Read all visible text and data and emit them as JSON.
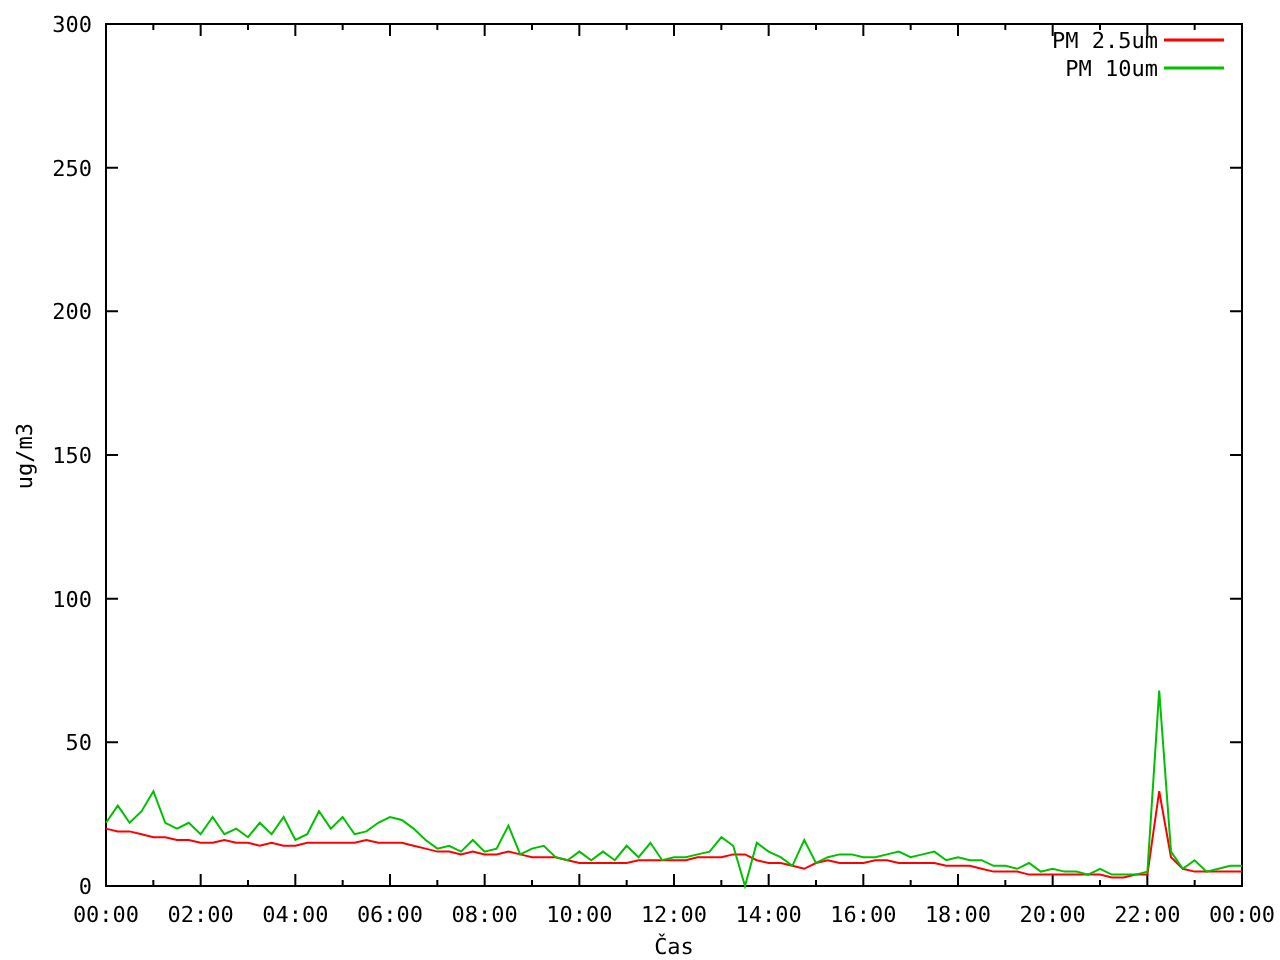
{
  "chart_data": {
    "type": "line",
    "xlabel": "Čas",
    "ylabel": "ug/m3",
    "x": [
      0,
      0.25,
      0.5,
      0.75,
      1,
      1.25,
      1.5,
      1.75,
      2,
      2.25,
      2.5,
      2.75,
      3,
      3.25,
      3.5,
      3.75,
      4,
      4.25,
      4.5,
      4.75,
      5,
      5.25,
      5.5,
      5.75,
      6,
      6.25,
      6.5,
      6.75,
      7,
      7.25,
      7.5,
      7.75,
      8,
      8.25,
      8.5,
      8.75,
      9,
      9.25,
      9.5,
      9.75,
      10,
      10.25,
      10.5,
      10.75,
      11,
      11.25,
      11.5,
      11.75,
      12,
      12.25,
      12.5,
      12.75,
      13,
      13.25,
      13.5,
      13.75,
      14,
      14.25,
      14.5,
      14.75,
      15,
      15.25,
      15.5,
      15.75,
      16,
      16.25,
      16.5,
      16.75,
      17,
      17.25,
      17.5,
      17.75,
      18,
      18.25,
      18.5,
      18.75,
      19,
      19.25,
      19.5,
      19.75,
      20,
      20.25,
      20.5,
      20.75,
      21,
      21.25,
      21.5,
      21.75,
      22,
      22.25,
      22.5,
      22.75,
      23,
      23.25,
      23.5,
      23.75,
      24
    ],
    "series": [
      {
        "name": "PM 2.5um",
        "color": "#ff0000",
        "values": [
          20,
          19,
          19,
          18,
          17,
          17,
          16,
          16,
          15,
          15,
          16,
          15,
          15,
          14,
          15,
          14,
          14,
          15,
          15,
          15,
          15,
          15,
          16,
          15,
          15,
          15,
          14,
          13,
          12,
          12,
          11,
          12,
          11,
          11,
          12,
          11,
          10,
          10,
          10,
          9,
          8,
          8,
          8,
          8,
          8,
          9,
          9,
          9,
          9,
          9,
          10,
          10,
          10,
          11,
          11,
          9,
          8,
          8,
          7,
          6,
          8,
          9,
          8,
          8,
          8,
          9,
          9,
          8,
          8,
          8,
          8,
          7,
          7,
          7,
          6,
          5,
          5,
          5,
          4,
          4,
          4,
          4,
          4,
          4,
          4,
          3,
          3,
          4,
          4,
          33,
          10,
          6,
          5,
          5,
          5,
          5,
          5
        ]
      },
      {
        "name": "PM 10um",
        "color": "#00c000",
        "values": [
          22,
          28,
          22,
          26,
          33,
          22,
          20,
          22,
          18,
          24,
          18,
          20,
          17,
          22,
          18,
          24,
          16,
          18,
          26,
          20,
          24,
          18,
          19,
          22,
          24,
          23,
          20,
          16,
          13,
          14,
          12,
          16,
          12,
          13,
          21,
          11,
          13,
          14,
          10,
          9,
          12,
          9,
          12,
          9,
          14,
          10,
          15,
          9,
          10,
          10,
          11,
          12,
          17,
          14,
          0,
          15,
          12,
          10,
          7,
          16,
          8,
          10,
          11,
          11,
          10,
          10,
          11,
          12,
          10,
          11,
          12,
          9,
          10,
          9,
          9,
          7,
          7,
          6,
          8,
          5,
          6,
          5,
          5,
          4,
          6,
          4,
          4,
          4,
          5,
          68,
          12,
          6,
          9,
          5,
          6,
          7,
          7
        ]
      }
    ],
    "xlim": [
      0,
      24
    ],
    "ylim": [
      0,
      300
    ],
    "xticks": [
      {
        "value": 0,
        "label": "00:00"
      },
      {
        "value": 2,
        "label": "02:00"
      },
      {
        "value": 4,
        "label": "04:00"
      },
      {
        "value": 6,
        "label": "06:00"
      },
      {
        "value": 8,
        "label": "08:00"
      },
      {
        "value": 10,
        "label": "10:00"
      },
      {
        "value": 12,
        "label": "12:00"
      },
      {
        "value": 14,
        "label": "14:00"
      },
      {
        "value": 16,
        "label": "16:00"
      },
      {
        "value": 18,
        "label": "18:00"
      },
      {
        "value": 20,
        "label": "20:00"
      },
      {
        "value": 22,
        "label": "22:00"
      },
      {
        "value": 24,
        "label": "00:00"
      }
    ],
    "yticks": [
      0,
      50,
      100,
      150,
      200,
      250,
      300
    ],
    "legend": true
  }
}
